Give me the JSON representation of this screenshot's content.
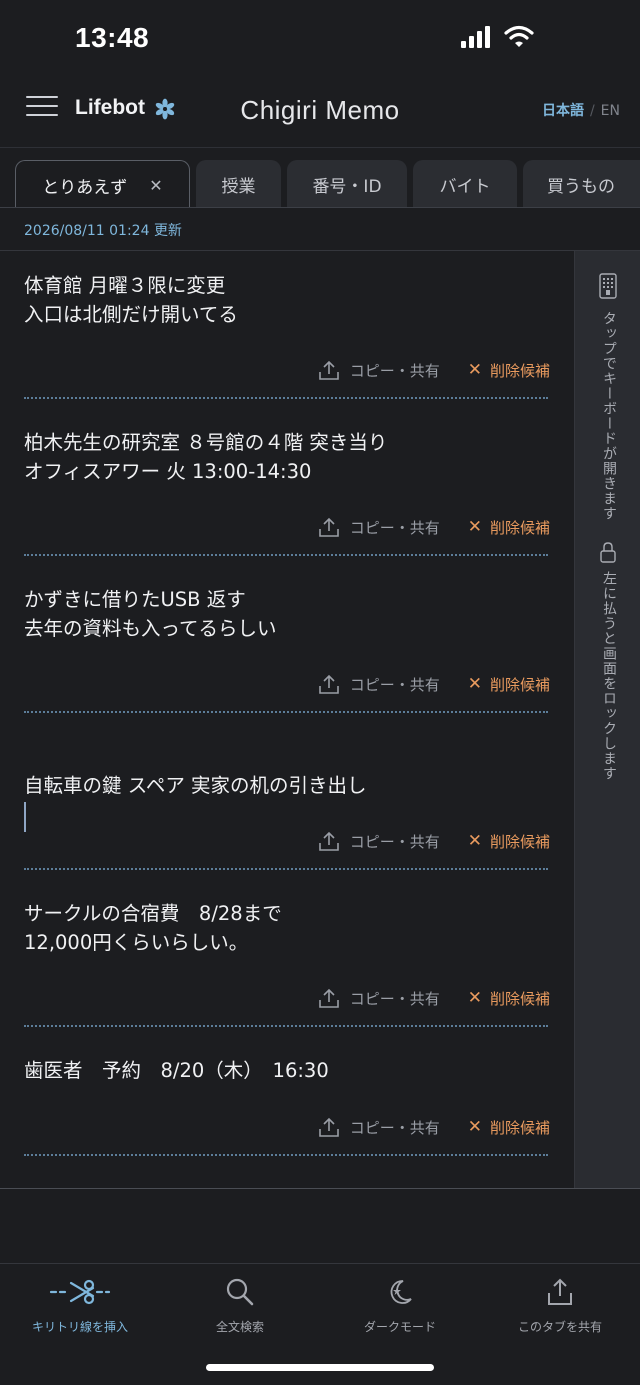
{
  "status_bar": {
    "time": "13:48"
  },
  "header": {
    "brand": "Lifebot",
    "title": "Chigiri Memo",
    "lang_ja": "日本語",
    "lang_sep": "/",
    "lang_en": "EN"
  },
  "tabs": [
    {
      "label": "とりあえず",
      "active": true,
      "close": "✕"
    },
    {
      "label": "授業"
    },
    {
      "label": "番号・ID"
    },
    {
      "label": "バイト"
    },
    {
      "label": "買うもの"
    }
  ],
  "updated": "2026/08/11 01:24 更新",
  "memo_actions": {
    "copy": "コピー・共有",
    "delete": "削除候補",
    "delete_mark": "✕"
  },
  "memos": [
    {
      "text": "体育館 月曜３限に変更\n入口は北側だけ開いてる"
    },
    {
      "text": "柏木先生の研究室 ８号館の４階 突き当り\nオフィスアワー 火 13:00-14:30"
    },
    {
      "text": "かずきに借りたUSB 返す\n去年の資料も入ってるらしい"
    },
    {
      "text": "自転車の鍵 スペア 実家の机の引き出し",
      "editing": true
    },
    {
      "text": "サークルの合宿費　8/28まで\n12,000円くらいらしい。"
    },
    {
      "text": "歯医者　予約　8/20（木）　16:30"
    }
  ],
  "side_panel": {
    "keyboard_hint": "タップでキーボードが開きます",
    "lock_hint": "左に払うと画面をロックします"
  },
  "toolbar": {
    "insert": "キリトリ線を挿入",
    "search": "全文検索",
    "dark": "ダークモード",
    "share": "このタブを共有"
  },
  "colors": {
    "background": "#1c1d20",
    "accent": "#7fb7dc",
    "delete": "#e89a5e",
    "divider": "#5c7d99"
  }
}
